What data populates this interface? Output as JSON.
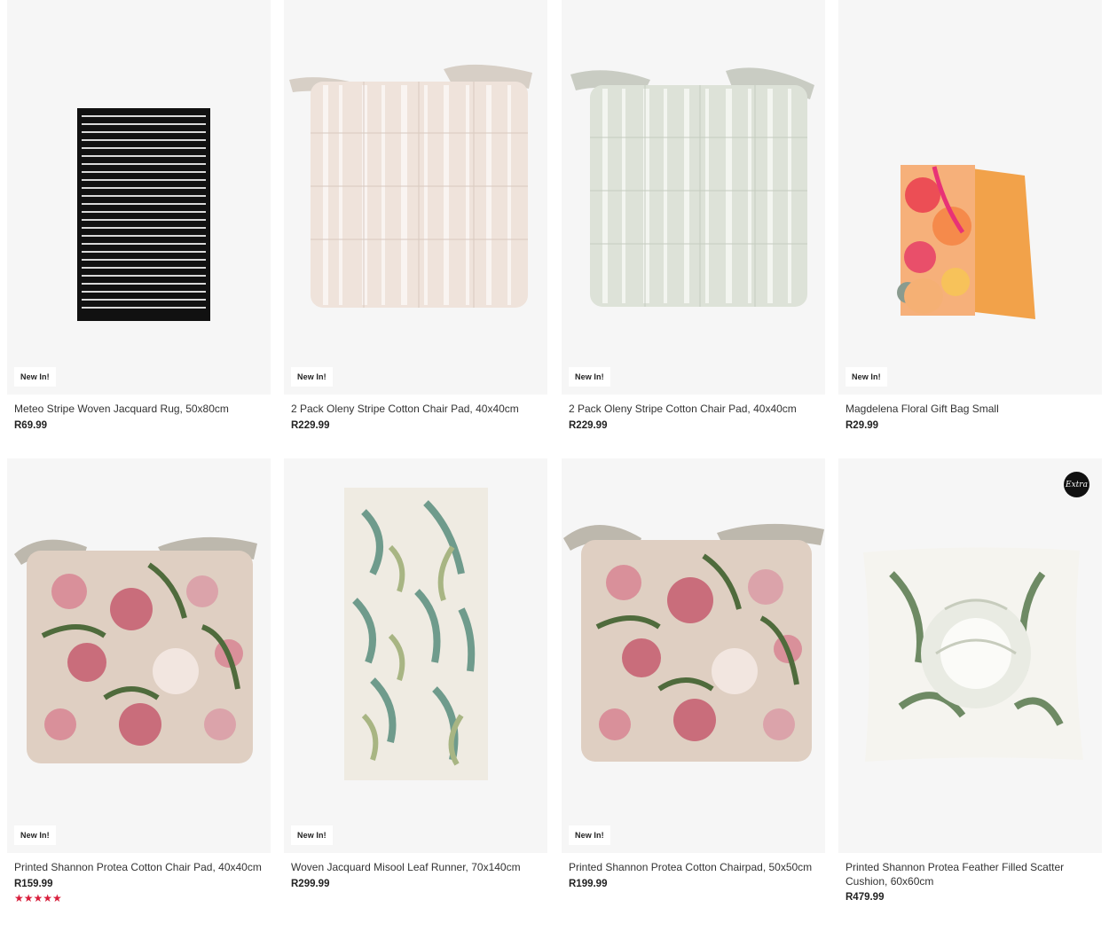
{
  "products": [
    {
      "title": "Meteo Stripe Woven Jacquard Rug, 50x80cm",
      "price": "R69.99",
      "badge": "New In!"
    },
    {
      "title": "2 Pack Oleny Stripe Cotton Chair Pad, 40x40cm",
      "price": "R229.99",
      "badge": "New In!"
    },
    {
      "title": "2 Pack Oleny Stripe Cotton Chair Pad, 40x40cm",
      "price": "R229.99",
      "badge": "New In!"
    },
    {
      "title": "Magdelena Floral Gift Bag Small",
      "price": "R29.99",
      "badge": "New In!"
    },
    {
      "title": "Printed Shannon Protea Cotton Chair Pad, 40x40cm",
      "price": "R159.99",
      "badge": "New In!",
      "rating": 5,
      "rating_stars": "★★★★★"
    },
    {
      "title": "Woven Jacquard Misool Leaf Runner, 70x140cm",
      "price": "R299.99",
      "badge": "New In!"
    },
    {
      "title": "Printed Shannon Protea Cotton Chairpad, 50x50cm",
      "price": "R199.99",
      "badge": "New In!"
    },
    {
      "title": "Printed Shannon Protea Feather Filled Scatter Cushion, 60x60cm",
      "price": "R479.99",
      "badge_icon": "extra-logo-badge",
      "badge_text": "Extra"
    }
  ],
  "colors": {
    "rating": "#d81f3c",
    "image_bg": "#f6f6f6"
  }
}
